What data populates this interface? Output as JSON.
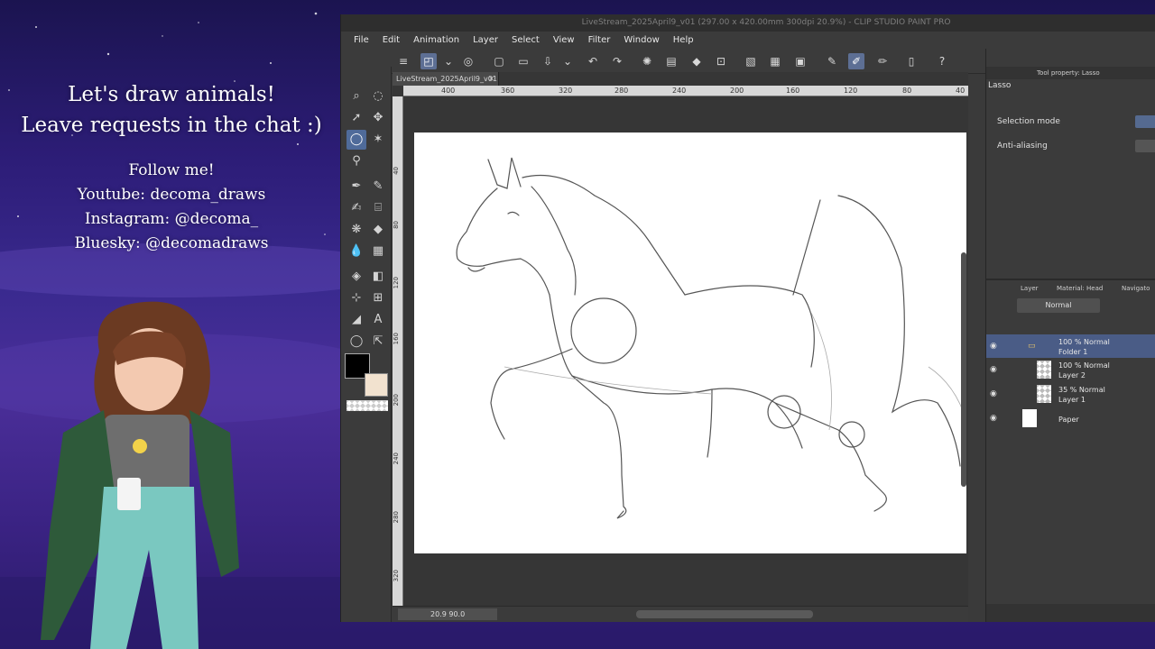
{
  "overlay": {
    "headline_line1": "Let's draw animals!",
    "headline_line2": "Leave requests in the chat :)",
    "follow_title": "Follow me!",
    "youtube": "Youtube: decoma_draws",
    "instagram": "Instagram: @decoma_",
    "bluesky": "Bluesky: @decomadraws"
  },
  "app": {
    "title": "LiveStream_2025April9_v01 (297.00 x 420.00mm 300dpi 20.9%) - CLIP STUDIO PAINT PRO",
    "menu": [
      "File",
      "Edit",
      "Animation",
      "Layer",
      "Select",
      "View",
      "Filter",
      "Window",
      "Help"
    ],
    "document_tab": "LiveStream_2025April9_v01",
    "zoom_readout": "20.9  90.0",
    "ruler_h_labels": [
      "400",
      "360",
      "320",
      "280",
      "240",
      "200",
      "160",
      "120",
      "80",
      "40"
    ],
    "ruler_v_labels": [
      "40",
      "80",
      "120",
      "160",
      "200",
      "240",
      "280",
      "320"
    ]
  },
  "tool_property": {
    "tab_label": "Tool property: Lasso",
    "tool_name": "Lasso",
    "selection_mode_label": "Selection mode",
    "antialiasing_label": "Anti-aliasing"
  },
  "layer_panel": {
    "tab_layer": "Layer",
    "tab_material": "Material: Head",
    "tab_navigator": "Navigato",
    "blend_mode": "Normal",
    "layers": [
      {
        "opacity": "100 %  Normal",
        "name": "Folder 1",
        "type": "folder",
        "selected": true
      },
      {
        "opacity": "100 %  Normal",
        "name": "Layer 2",
        "type": "raster",
        "selected": false
      },
      {
        "opacity": "35 %  Normal",
        "name": "Layer 1",
        "type": "raster",
        "selected": false
      },
      {
        "opacity": "",
        "name": "Paper",
        "type": "paper",
        "selected": false
      }
    ]
  },
  "colors": {
    "main": "#000000",
    "sub": "#f2e2cf",
    "accent": "#4f6b9a"
  }
}
